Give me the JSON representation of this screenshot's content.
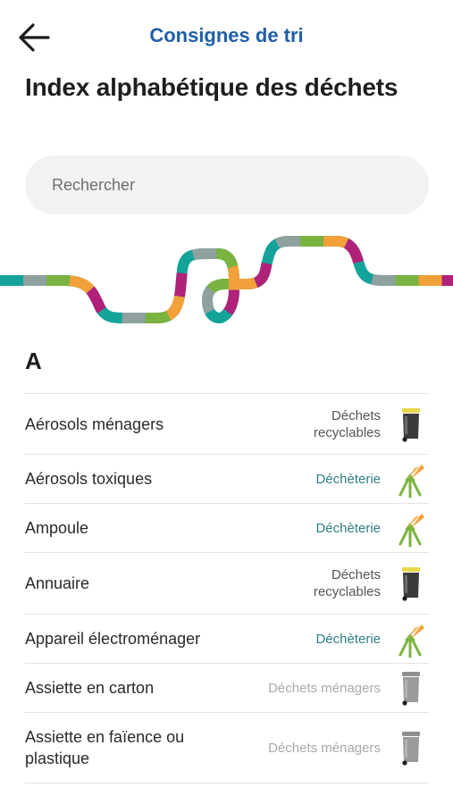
{
  "header": {
    "back_icon": "arrow-left-icon",
    "title": "Consignes de tri"
  },
  "page": {
    "title": "Index alphabétique des déchets"
  },
  "search": {
    "placeholder": "Rechercher",
    "value": ""
  },
  "decor": {
    "colors": [
      "#14a39a",
      "#8fa19e",
      "#7ab33f",
      "#f2a03a",
      "#b0227a"
    ]
  },
  "section": {
    "letter": "A"
  },
  "items": [
    {
      "name": "Aérosols ménagers",
      "category_lines": [
        "Déchets",
        "recyclables"
      ],
      "type": "recyclable",
      "icon": "yellow-lid-bin-icon"
    },
    {
      "name": "Aérosols toxiques",
      "category_lines": [
        "Déchèterie"
      ],
      "type": "dechetterie",
      "icon": "dechetterie-arrows-icon"
    },
    {
      "name": "Ampoule",
      "category_lines": [
        "Déchèterie"
      ],
      "type": "dechetterie",
      "icon": "dechetterie-arrows-icon"
    },
    {
      "name": "Annuaire",
      "category_lines": [
        "Déchets",
        "recyclables"
      ],
      "type": "recyclable",
      "icon": "yellow-lid-bin-icon"
    },
    {
      "name": "Appareil électroménager",
      "category_lines": [
        "Déchèterie"
      ],
      "type": "dechetterie",
      "icon": "dechetterie-arrows-icon"
    },
    {
      "name": "Assiette en carton",
      "category_lines": [
        "Déchets ménagers"
      ],
      "type": "menagers",
      "icon": "grey-bin-icon"
    },
    {
      "name": "Assiette en faïence ou plastique",
      "category_lines": [
        "Déchets ménagers"
      ],
      "type": "menagers",
      "icon": "grey-bin-icon"
    }
  ]
}
